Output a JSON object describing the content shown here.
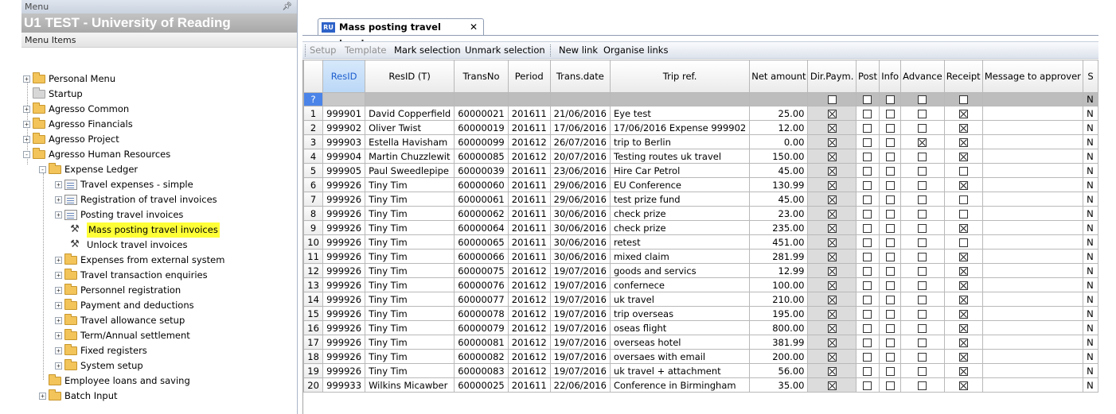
{
  "menu_panel": {
    "title": "Menu",
    "pin_icon": "pin-icon",
    "system_title": "U1 TEST - University of Reading",
    "items_header": "Menu Items",
    "tree": [
      {
        "label": "Personal Menu",
        "level": 0,
        "icon": "folder-icon",
        "expander": "+"
      },
      {
        "label": "Startup",
        "level": 0,
        "icon": "folder-grey-icon",
        "expander": ""
      },
      {
        "label": "Agresso Common",
        "level": 0,
        "icon": "folder-icon",
        "expander": "+"
      },
      {
        "label": "Agresso Financials",
        "level": 0,
        "icon": "folder-icon",
        "expander": "+"
      },
      {
        "label": "Agresso Project",
        "level": 0,
        "icon": "folder-icon",
        "expander": "+"
      },
      {
        "label": "Agresso Human Resources",
        "level": 0,
        "icon": "folder-open-icon",
        "expander": "-"
      },
      {
        "label": "Expense Ledger",
        "level": 1,
        "icon": "folder-open-icon",
        "expander": "-"
      },
      {
        "label": "Travel expenses - simple",
        "level": 2,
        "icon": "document-icon",
        "expander": "+"
      },
      {
        "label": "Registration of travel invoices",
        "level": 2,
        "icon": "document-icon",
        "expander": "+"
      },
      {
        "label": "Posting travel invoices",
        "level": 2,
        "icon": "document-icon",
        "expander": "+"
      },
      {
        "label": "Mass posting travel invoices",
        "level": 3,
        "icon": "tools-icon",
        "expander": "",
        "highlight": true
      },
      {
        "label": "Unlock travel invoices",
        "level": 3,
        "icon": "tools-icon",
        "expander": ""
      },
      {
        "label": "Expenses from external system",
        "level": 2,
        "icon": "folder-icon",
        "expander": "+"
      },
      {
        "label": "Travel transaction enquiries",
        "level": 2,
        "icon": "folder-icon",
        "expander": "+"
      },
      {
        "label": "Personnel registration",
        "level": 2,
        "icon": "folder-icon",
        "expander": "+"
      },
      {
        "label": "Payment and deductions",
        "level": 2,
        "icon": "folder-icon",
        "expander": "+"
      },
      {
        "label": "Travel allowance setup",
        "level": 2,
        "icon": "folder-icon",
        "expander": "+"
      },
      {
        "label": "Term/Annual settlement",
        "level": 2,
        "icon": "folder-icon",
        "expander": "+"
      },
      {
        "label": "Fixed registers",
        "level": 2,
        "icon": "folder-icon",
        "expander": "+"
      },
      {
        "label": "System setup",
        "level": 2,
        "icon": "folder-icon",
        "expander": "+"
      },
      {
        "label": "Employee loans and saving",
        "level": 1,
        "icon": "folder-icon",
        "expander": ""
      },
      {
        "label": "Batch Input",
        "level": 1,
        "icon": "folder-icon",
        "expander": "+"
      }
    ]
  },
  "tab": {
    "icon_text": "RU",
    "label": "Mass posting travel invoices",
    "close_label": "✕"
  },
  "toolbar": {
    "setup": "Setup",
    "template": "Template",
    "mark_selection": "Mark selection",
    "unmark_selection": "Unmark selection",
    "new_link": "New link",
    "organise_links": "Organise links"
  },
  "grid": {
    "columns": [
      "",
      "ResID",
      "ResID (T)",
      "TransNo",
      "Period",
      "Trans.date",
      "Trip ref.",
      "Net amount",
      "Dir.Paym.",
      "Post",
      "Info",
      "Advance",
      "Receipt",
      "Message to approver",
      "S"
    ],
    "filter_row": {
      "row_marker": "?",
      "s_value": "N"
    },
    "rows": [
      {
        "n": "1",
        "resid": "999901",
        "name": "David Copperfield",
        "transno": "60000021",
        "period": "201611",
        "date": "21/06/2016",
        "trip": "Eye test",
        "amount": "25.00",
        "dir": true,
        "post": false,
        "info": false,
        "adv": false,
        "rec": true,
        "s": "N"
      },
      {
        "n": "2",
        "resid": "999902",
        "name": "Oliver Twist",
        "transno": "60000019",
        "period": "201611",
        "date": "17/06/2016",
        "trip": "17/06/2016 Expense 999902",
        "amount": "12.00",
        "dir": true,
        "post": false,
        "info": false,
        "adv": false,
        "rec": true,
        "s": "N"
      },
      {
        "n": "3",
        "resid": "999903",
        "name": "Estella Havisham",
        "transno": "60000099",
        "period": "201612",
        "date": "26/07/2016",
        "trip": "trip to Berlin",
        "amount": "0.00",
        "dir": true,
        "post": false,
        "info": false,
        "adv": true,
        "rec": true,
        "s": "N"
      },
      {
        "n": "4",
        "resid": "999904",
        "name": "Martin Chuzzlewit",
        "transno": "60000085",
        "period": "201612",
        "date": "20/07/2016",
        "trip": "Testing routes uk travel",
        "amount": "150.00",
        "dir": true,
        "post": false,
        "info": false,
        "adv": false,
        "rec": true,
        "s": "N"
      },
      {
        "n": "5",
        "resid": "999905",
        "name": "Paul Sweedlepipe",
        "transno": "60000039",
        "period": "201611",
        "date": "23/06/2016",
        "trip": "Hire Car Petrol",
        "amount": "45.00",
        "dir": true,
        "post": false,
        "info": false,
        "adv": false,
        "rec": false,
        "s": "N"
      },
      {
        "n": "6",
        "resid": "999926",
        "name": "Tiny Tim",
        "transno": "60000060",
        "period": "201611",
        "date": "29/06/2016",
        "trip": "EU Conference",
        "amount": "130.99",
        "dir": true,
        "post": false,
        "info": false,
        "adv": false,
        "rec": true,
        "s": "N"
      },
      {
        "n": "7",
        "resid": "999926",
        "name": "Tiny Tim",
        "transno": "60000061",
        "period": "201611",
        "date": "29/06/2016",
        "trip": "test prize fund",
        "amount": "45.00",
        "dir": true,
        "post": false,
        "info": false,
        "adv": false,
        "rec": false,
        "s": "N"
      },
      {
        "n": "8",
        "resid": "999926",
        "name": "Tiny Tim",
        "transno": "60000062",
        "period": "201611",
        "date": "30/06/2016",
        "trip": "check prize",
        "amount": "23.00",
        "dir": true,
        "post": false,
        "info": false,
        "adv": false,
        "rec": false,
        "s": "N"
      },
      {
        "n": "9",
        "resid": "999926",
        "name": "Tiny Tim",
        "transno": "60000064",
        "period": "201611",
        "date": "30/06/2016",
        "trip": "check prize",
        "amount": "235.00",
        "dir": true,
        "post": false,
        "info": false,
        "adv": false,
        "rec": true,
        "s": "N"
      },
      {
        "n": "10",
        "resid": "999926",
        "name": "Tiny Tim",
        "transno": "60000065",
        "period": "201611",
        "date": "30/06/2016",
        "trip": "retest",
        "amount": "451.00",
        "dir": true,
        "post": false,
        "info": false,
        "adv": false,
        "rec": false,
        "s": "N"
      },
      {
        "n": "11",
        "resid": "999926",
        "name": "Tiny Tim",
        "transno": "60000066",
        "period": "201611",
        "date": "30/06/2016",
        "trip": "mixed claim",
        "amount": "281.99",
        "dir": true,
        "post": false,
        "info": false,
        "adv": false,
        "rec": true,
        "s": "N"
      },
      {
        "n": "12",
        "resid": "999926",
        "name": "Tiny Tim",
        "transno": "60000075",
        "period": "201612",
        "date": "19/07/2016",
        "trip": "goods and servics",
        "amount": "12.99",
        "dir": true,
        "post": false,
        "info": false,
        "adv": false,
        "rec": true,
        "s": "N"
      },
      {
        "n": "13",
        "resid": "999926",
        "name": "Tiny Tim",
        "transno": "60000076",
        "period": "201612",
        "date": "19/07/2016",
        "trip": "confernece",
        "amount": "100.00",
        "dir": true,
        "post": false,
        "info": false,
        "adv": false,
        "rec": true,
        "s": "N"
      },
      {
        "n": "14",
        "resid": "999926",
        "name": "Tiny Tim",
        "transno": "60000077",
        "period": "201612",
        "date": "19/07/2016",
        "trip": "uk travel",
        "amount": "210.00",
        "dir": true,
        "post": false,
        "info": false,
        "adv": false,
        "rec": true,
        "s": "N"
      },
      {
        "n": "15",
        "resid": "999926",
        "name": "Tiny Tim",
        "transno": "60000078",
        "period": "201612",
        "date": "19/07/2016",
        "trip": "trip overseas",
        "amount": "195.00",
        "dir": true,
        "post": false,
        "info": false,
        "adv": false,
        "rec": true,
        "s": "N"
      },
      {
        "n": "16",
        "resid": "999926",
        "name": "Tiny Tim",
        "transno": "60000079",
        "period": "201612",
        "date": "19/07/2016",
        "trip": "oseas flight",
        "amount": "800.00",
        "dir": true,
        "post": false,
        "info": false,
        "adv": false,
        "rec": true,
        "s": "N"
      },
      {
        "n": "17",
        "resid": "999926",
        "name": "Tiny Tim",
        "transno": "60000081",
        "period": "201612",
        "date": "19/07/2016",
        "trip": "overseas hotel",
        "amount": "381.99",
        "dir": true,
        "post": false,
        "info": false,
        "adv": false,
        "rec": true,
        "s": "N"
      },
      {
        "n": "18",
        "resid": "999926",
        "name": "Tiny Tim",
        "transno": "60000082",
        "period": "201612",
        "date": "19/07/2016",
        "trip": "oversaes with email",
        "amount": "200.00",
        "dir": true,
        "post": false,
        "info": false,
        "adv": false,
        "rec": true,
        "s": "N"
      },
      {
        "n": "19",
        "resid": "999926",
        "name": "Tiny Tim",
        "transno": "60000083",
        "period": "201612",
        "date": "19/07/2016",
        "trip": "uk travel + attachment",
        "amount": "56.00",
        "dir": true,
        "post": false,
        "info": false,
        "adv": false,
        "rec": true,
        "s": "N"
      },
      {
        "n": "20",
        "resid": "999933",
        "name": "Wilkins Micawber",
        "transno": "60000025",
        "period": "201611",
        "date": "22/06/2016",
        "trip": "Conference in Birmingham",
        "amount": "35.00",
        "dir": true,
        "post": false,
        "info": false,
        "adv": false,
        "rec": true,
        "s": "N"
      }
    ]
  },
  "colors": {
    "highlight": "#ffff38",
    "selected_header": "#1f5fcf",
    "folder": "#f2c45a"
  }
}
